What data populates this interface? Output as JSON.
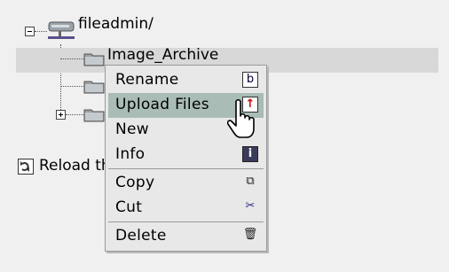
{
  "tree": {
    "root_label": "fileadmin/",
    "children": [
      {
        "label": "Image_Archive"
      },
      {
        "label": ""
      },
      {
        "label": ""
      }
    ],
    "reload_label": "Reload the tree from server"
  },
  "context_menu": {
    "items": [
      {
        "label": "Rename",
        "icon": "rename-icon"
      },
      {
        "label": "Upload Files",
        "icon": "upload-icon"
      },
      {
        "label": "New",
        "icon": "new-file-icon"
      },
      {
        "label": "Info",
        "icon": "info-icon"
      },
      {
        "label": "Copy",
        "icon": "copy-icon"
      },
      {
        "label": "Cut",
        "icon": "scissors-icon"
      },
      {
        "label": "Delete",
        "icon": "trash-icon"
      }
    ]
  },
  "colors": {
    "background": "#f0f0f0",
    "menu_background": "#e8e8e8",
    "menu_highlight": "#a9bcb6",
    "row_highlight": "#d8d8d8"
  }
}
